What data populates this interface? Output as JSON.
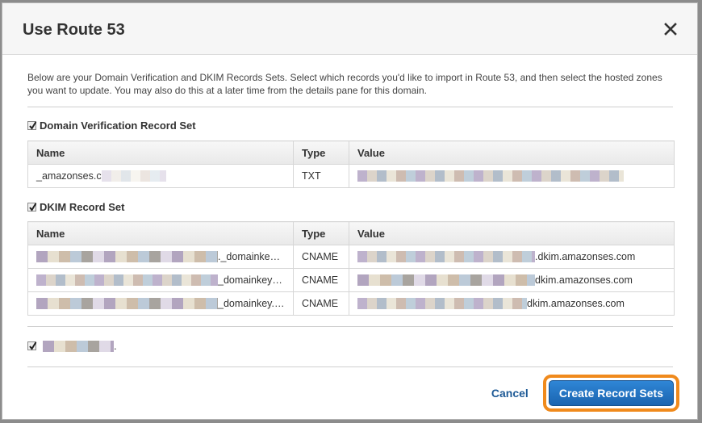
{
  "dialog": {
    "title": "Use Route 53",
    "intro": "Below are your Domain Verification and DKIM Records Sets. Select which records you'd like to import in Route 53, and then select the hosted zones you want to update. You may also do this at a later time from the details pane for this domain."
  },
  "verification": {
    "label": "Domain Verification Record Set",
    "checked": true,
    "columns": [
      "Name",
      "Type",
      "Value"
    ],
    "rows": [
      {
        "name": "_amazonses.c",
        "type": "TXT",
        "value": ""
      }
    ]
  },
  "dkim": {
    "label": "DKIM Record Set",
    "checked": true,
    "columns": [
      "Name",
      "Type",
      "Value"
    ],
    "rows": [
      {
        "name": "._domainke…",
        "type": "CNAME",
        "value": ".dkim.amazonses.com"
      },
      {
        "name": "_domainkey…",
        "type": "CNAME",
        "value": "dkim.amazonses.com"
      },
      {
        "name": "_domainkey.…",
        "type": "CNAME",
        "value": "dkim.amazonses.com"
      }
    ]
  },
  "hosted_zone": {
    "label": ".",
    "checked": true
  },
  "footer": {
    "cancel": "Cancel",
    "create": "Create Record Sets"
  },
  "colors": {
    "accent_border": "#f08a1c",
    "primary": "#1a64b0",
    "link": "#1e5a96"
  }
}
